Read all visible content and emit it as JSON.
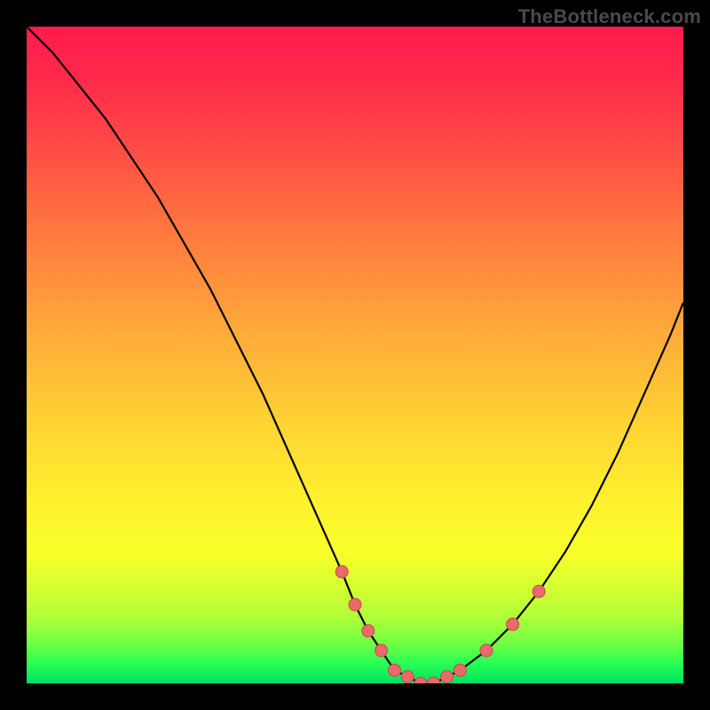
{
  "watermark": "TheBottleneck.com",
  "colors": {
    "frame_bg": "#000000",
    "curve": "#000000",
    "marker_fill": "#e86a6a",
    "marker_stroke": "#c84a4a",
    "gradient_top": "#ff1a4d",
    "gradient_bottom": "#00e060"
  },
  "chart_data": {
    "type": "line",
    "title": "",
    "xlabel": "",
    "ylabel": "",
    "xlim": [
      0,
      100
    ],
    "ylim": [
      0,
      100
    ],
    "curve": {
      "x": [
        0,
        4,
        8,
        12,
        16,
        20,
        24,
        28,
        32,
        36,
        40,
        44,
        48,
        50,
        52,
        54,
        56,
        58,
        60,
        62,
        64,
        66,
        70,
        74,
        78,
        82,
        86,
        90,
        94,
        98,
        100
      ],
      "y": [
        100,
        96,
        91,
        86,
        80,
        74,
        67,
        60,
        52,
        44,
        35,
        26,
        17,
        12,
        8,
        5,
        2,
        1,
        0,
        0,
        1,
        2,
        5,
        9,
        14,
        20,
        27,
        35,
        44,
        53,
        58
      ]
    },
    "markers": {
      "x": [
        48,
        50,
        52,
        54,
        56,
        58,
        60,
        62,
        64,
        66,
        70,
        74,
        78
      ],
      "y": [
        17,
        12,
        8,
        5,
        2,
        1,
        0,
        0,
        1,
        2,
        5,
        9,
        14
      ]
    }
  }
}
